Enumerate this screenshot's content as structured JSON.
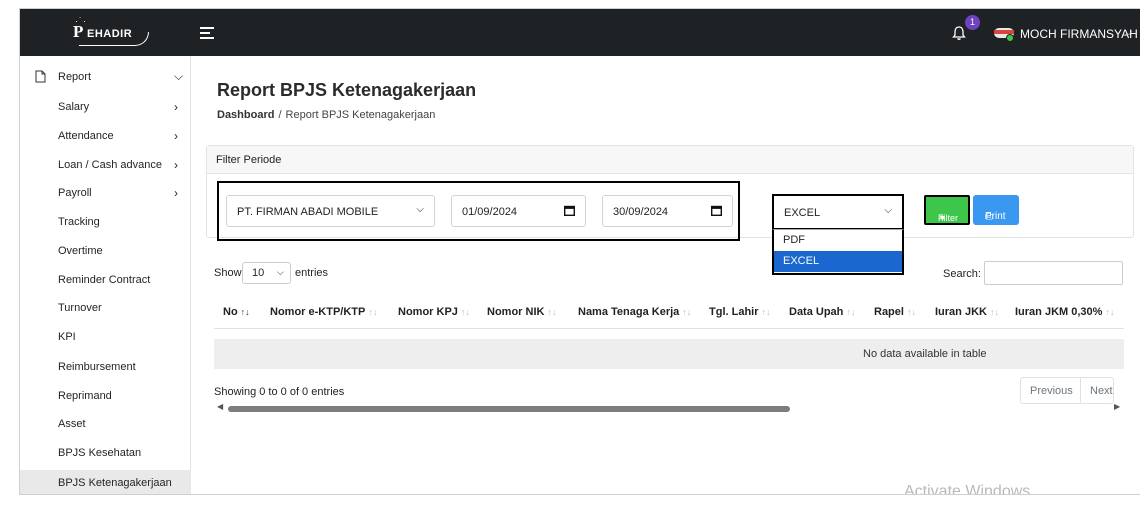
{
  "app": {
    "brand": "EHADIR"
  },
  "header": {
    "notification_count": "1",
    "user_name": "MOCH FIRMANSYAH"
  },
  "sidebar": {
    "items": [
      {
        "label": "Report",
        "chevron": "down"
      },
      {
        "label": "Salary",
        "chevron": "right"
      },
      {
        "label": "Attendance",
        "chevron": "right"
      },
      {
        "label": "Loan / Cash advance",
        "chevron": "right"
      },
      {
        "label": "Payroll",
        "chevron": "right"
      },
      {
        "label": "Tracking"
      },
      {
        "label": "Overtime"
      },
      {
        "label": "Reminder Contract"
      },
      {
        "label": "Turnover"
      },
      {
        "label": "KPI"
      },
      {
        "label": "Reimbursement"
      },
      {
        "label": "Reprimand"
      },
      {
        "label": "Asset"
      },
      {
        "label": "BPJS Kesehatan"
      },
      {
        "label": "BPJS Ketenagakerjaan",
        "active": true
      }
    ]
  },
  "main": {
    "title": "Report BPJS Ketenagakerjaan",
    "breadcrumb": {
      "home": "Dashboard",
      "separator": "/",
      "current": "Report BPJS Ketenagakerjaan"
    },
    "filter": {
      "header": "Filter Periode",
      "company": "PT. FIRMAN ABADI MOBILE",
      "date_from": "01/09/2024",
      "date_to": "30/09/2024",
      "format_selected": "EXCEL",
      "format_options": [
        "PDF",
        "EXCEL"
      ],
      "filter_button": "Filter",
      "print_button": "Print"
    },
    "table": {
      "show_label": "Show",
      "page_length": "10",
      "entries_label": "entries",
      "search_label": "Search:",
      "columns": [
        "No",
        "Nomor e-KTP/KTP",
        "Nomor KPJ",
        "Nomor NIK",
        "Nama Tenaga Kerja",
        "Tgl. Lahir",
        "Data Upah",
        "Rapel",
        "Iuran JKK",
        "Iuran JKM 0,30%"
      ],
      "empty_message": "No data available in table",
      "info": "Showing 0 to 0 of 0 entries",
      "pagination": {
        "previous": "Previous",
        "next": "Next"
      }
    }
  },
  "watermark": "Activate Windows",
  "colors": {
    "topbar": "#1f2224",
    "filter_button": "#3ec64a",
    "print_button": "#3a98f0",
    "selected_option": "#1a67d0",
    "badge": "#6f42c1"
  }
}
